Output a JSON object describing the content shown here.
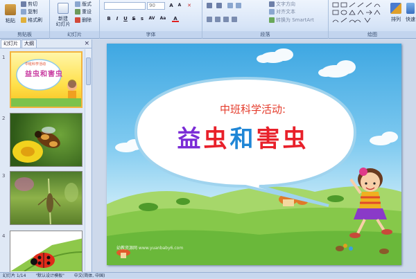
{
  "ribbon": {
    "clipboard": {
      "paste": "粘贴",
      "cut": "剪切",
      "copy": "复制",
      "format_painter": "格式刷",
      "label": "剪贴板"
    },
    "slides": {
      "new_slide": "新建\n幻灯片",
      "layout": "版式",
      "reset": "重设",
      "delete": "删除",
      "label": "幻灯片"
    },
    "font": {
      "font_size": "90",
      "label": "字体"
    },
    "paragraph": {
      "text_direction": "文字方向",
      "align_text": "对齐文本",
      "smartart": "转换为 SmartArt",
      "label": "段落"
    },
    "drawing": {
      "arrange": "排列",
      "quick_styles": "快速",
      "label": "绘图"
    }
  },
  "panel": {
    "tab_slides": "幻灯片",
    "tab_outline": "大纲",
    "close": "×",
    "thumbs": [
      {
        "num": "1",
        "title": "益虫和害虫",
        "subtitle": "中班科学活动"
      },
      {
        "num": "2"
      },
      {
        "num": "3"
      },
      {
        "num": "4"
      }
    ]
  },
  "slide": {
    "subtitle": "中班科学活动:",
    "title_chars": [
      "益",
      "虫",
      "和",
      "害",
      "虫"
    ],
    "title_colors": [
      "#7a2bd6",
      "#e8202a",
      "#1f86d6",
      "#e8202a",
      "#e8202a"
    ],
    "watermark": "幼教资源网 www.yuanbaby6.com"
  },
  "status": {
    "slide_count": "幻灯片 1/14",
    "theme": "\"默认设计模板\"",
    "language": "中文(简体, 中国)"
  }
}
